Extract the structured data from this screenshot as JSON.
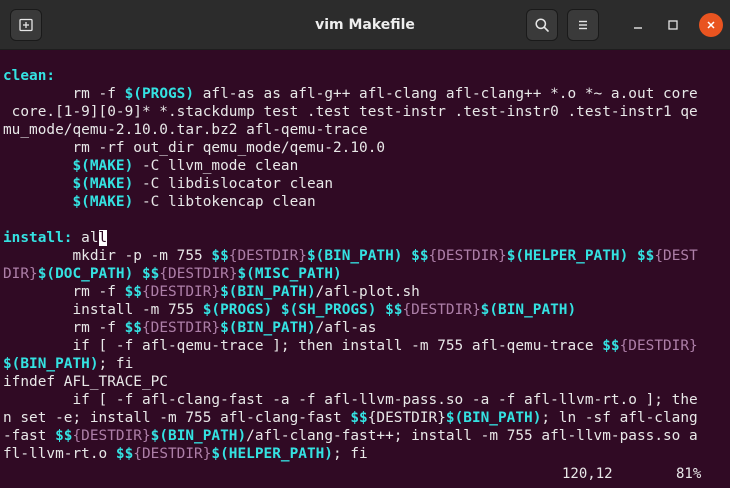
{
  "window": {
    "title": "vim Makefile"
  },
  "colors": {
    "terminal_bg": "#300a24",
    "titlebar_bg": "#2c2c2c",
    "keyword": "#34e2e2",
    "variable": "#ad7fa8",
    "close_button": "#e95420"
  },
  "icons": {
    "new_tab": "new-tab-icon",
    "search": "search-icon",
    "menu": "hamburger-menu-icon",
    "minimize": "minimize-icon",
    "maximize": "maximize-icon",
    "close": "close-icon"
  },
  "lines": [
    [
      {
        "t": "clean:",
        "c": "c"
      }
    ],
    [
      {
        "t": "        rm -f "
      },
      {
        "t": "$(PROGS)",
        "c": "c"
      },
      {
        "t": " afl-as as afl-g++ afl-clang afl-clang++ *.o *~ a.out core"
      }
    ],
    [
      {
        "t": " core.[1-9][0-9]* *.stackdump test .test test-instr .test-instr0 .test-instr1 qe"
      }
    ],
    [
      {
        "t": "mu_mode/qemu-2.10.0.tar.bz2 afl-qemu-trace"
      }
    ],
    [
      {
        "t": "        rm -rf out_dir qemu_mode/qemu-2.10.0"
      }
    ],
    [
      {
        "t": "        "
      },
      {
        "t": "$(MAKE)",
        "c": "c"
      },
      {
        "t": " -C llvm_mode clean"
      }
    ],
    [
      {
        "t": "        "
      },
      {
        "t": "$(MAKE)",
        "c": "c"
      },
      {
        "t": " -C libdislocator clean"
      }
    ],
    [
      {
        "t": "        "
      },
      {
        "t": "$(MAKE)",
        "c": "c"
      },
      {
        "t": " -C libtokencap clean"
      }
    ],
    [
      {
        "t": ""
      }
    ],
    [
      {
        "t": "install:",
        "c": "c"
      },
      {
        "t": " al"
      },
      {
        "t": "l",
        "c": "cur"
      }
    ],
    [
      {
        "t": "        mkdir -p -m 755 "
      },
      {
        "t": "$$",
        "c": "c"
      },
      {
        "t": "{DESTDIR}",
        "c": "var"
      },
      {
        "t": "$(BIN_PATH)",
        "c": "c"
      },
      {
        "t": " "
      },
      {
        "t": "$$",
        "c": "c"
      },
      {
        "t": "{DESTDIR}",
        "c": "var"
      },
      {
        "t": "$(HELPER_PATH)",
        "c": "c"
      },
      {
        "t": " "
      },
      {
        "t": "$$",
        "c": "c"
      },
      {
        "t": "{DEST",
        "c": "var"
      }
    ],
    [
      {
        "t": "DIR}",
        "c": "var"
      },
      {
        "t": "$(DOC_PATH)",
        "c": "c"
      },
      {
        "t": " "
      },
      {
        "t": "$$",
        "c": "c"
      },
      {
        "t": "{DESTDIR}",
        "c": "var"
      },
      {
        "t": "$(MISC_PATH)",
        "c": "c"
      }
    ],
    [
      {
        "t": "        rm -f "
      },
      {
        "t": "$$",
        "c": "c"
      },
      {
        "t": "{DESTDIR}",
        "c": "var"
      },
      {
        "t": "$(BIN_PATH)",
        "c": "c"
      },
      {
        "t": "/afl-plot.sh"
      }
    ],
    [
      {
        "t": "        install -m 755 "
      },
      {
        "t": "$(PROGS)",
        "c": "c"
      },
      {
        "t": " "
      },
      {
        "t": "$(SH_PROGS)",
        "c": "c"
      },
      {
        "t": " "
      },
      {
        "t": "$$",
        "c": "c"
      },
      {
        "t": "{DESTDIR}",
        "c": "var"
      },
      {
        "t": "$(BIN_PATH)",
        "c": "c"
      }
    ],
    [
      {
        "t": "        rm -f "
      },
      {
        "t": "$$",
        "c": "c"
      },
      {
        "t": "{DESTDIR}",
        "c": "var"
      },
      {
        "t": "$(BIN_PATH)",
        "c": "c"
      },
      {
        "t": "/afl-as"
      }
    ],
    [
      {
        "t": "        if [ -f afl-qemu-trace ]; then install -m 755 afl-qemu-trace "
      },
      {
        "t": "$$",
        "c": "c"
      },
      {
        "t": "{DESTDIR}",
        "c": "var"
      }
    ],
    [
      {
        "t": "$(BIN_PATH)",
        "c": "c"
      },
      {
        "t": "; fi"
      }
    ],
    [
      {
        "t": "ifndef AFL_TRACE_PC"
      }
    ],
    [
      {
        "t": "        if [ -f afl-clang-fast -a -f afl-llvm-pass.so -a -f afl-llvm-rt.o ]; the"
      }
    ],
    [
      {
        "t": "n set -e; install -m 755 afl-clang-fast "
      },
      {
        "t": "$$",
        "c": "c"
      },
      {
        "t": "{DESTDIR}"
      },
      {
        "t": "$(BIN_PATH)",
        "c": "c"
      },
      {
        "t": "; ln -sf afl-clang"
      }
    ],
    [
      {
        "t": "-fast "
      },
      {
        "t": "$$",
        "c": "c"
      },
      {
        "t": "{DESTDIR}",
        "c": "var"
      },
      {
        "t": "$(BIN_PATH)",
        "c": "c"
      },
      {
        "t": "/afl-clang-fast++; install -m 755 afl-llvm-pass.so a"
      }
    ],
    [
      {
        "t": "fl-llvm-rt.o "
      },
      {
        "t": "$$",
        "c": "c"
      },
      {
        "t": "{DESTDIR}",
        "c": "var"
      },
      {
        "t": "$(HELPER_PATH)",
        "c": "c"
      },
      {
        "t": "; fi"
      }
    ]
  ],
  "status": {
    "position": "120,12",
    "percent": "81%"
  }
}
